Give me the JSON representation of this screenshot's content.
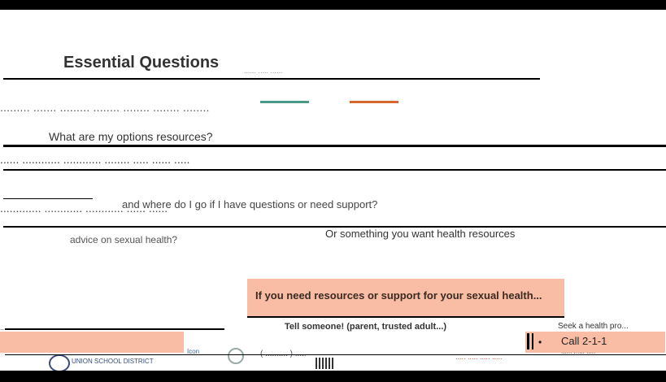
{
  "slide": {
    "title": "Essential Questions",
    "title_smudge": "...... ..... ......",
    "lines": [
      "......... ....... ......... ........ ........ ........ ........",
      "What are my options resources?",
      "...... ............ ............ ........ ..... ...... .....",
      "and where do I go if I have questions or need support?",
      "............. ............ ............ ...... ......",
      "advice on sexual health?"
    ],
    "aside_line": "Or something you want health resources"
  },
  "callout": {
    "text": "If you need resources or support for your sexual health..."
  },
  "tell": {
    "text": "Tell someone! (parent, trusted adult...)"
  },
  "seek": {
    "text": "Seek a health pro..."
  },
  "footer": {
    "left_text": "............. .....................",
    "call_label": "Call 2-1-1",
    "call_sub": "...... ...... .....",
    "logo_text": "UNION SCHOOL DISTRICT",
    "small_link": "Icon",
    "page_indicator": "( .......... ) .....",
    "right_text": "..... ..... ..... ....."
  },
  "colors": {
    "accent_salmon": "#f9bda6",
    "accent_orange": "#d9682e",
    "accent_teal": "#4a9a8a"
  }
}
